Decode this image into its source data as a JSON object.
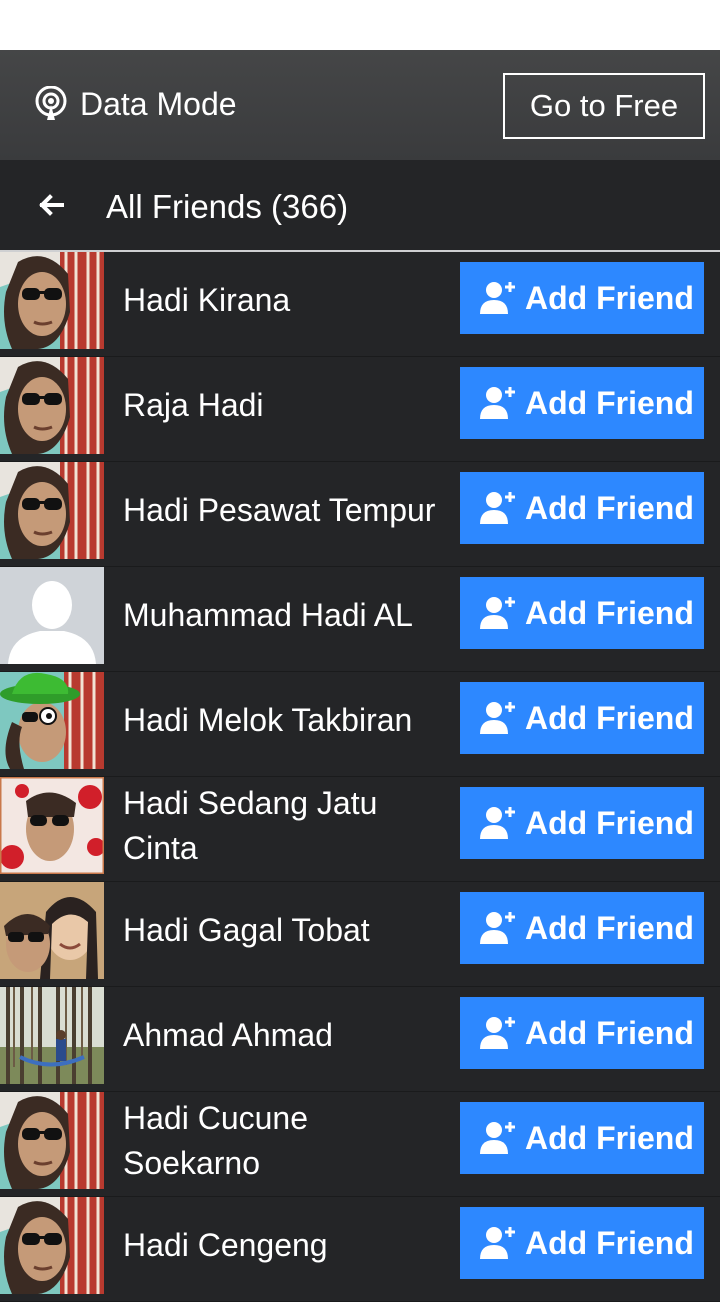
{
  "colors": {
    "accent": "#2d88ff",
    "background": "#242527",
    "topbar": "#3f4042"
  },
  "data_mode": {
    "label": "Data Mode",
    "icon": "broadcast-icon",
    "go_free_label": "Go to Free"
  },
  "header": {
    "back_icon": "arrow-left-icon",
    "title": "All Friends (366)"
  },
  "friends": [
    {
      "name": "Hadi Kirana",
      "button": "Add Friend",
      "avatar": "sunglasses-photo"
    },
    {
      "name": "Raja Hadi",
      "button": "Add Friend",
      "avatar": "sunglasses-photo"
    },
    {
      "name": "Hadi Pesawat Tempur",
      "button": "Add Friend",
      "avatar": "sunglasses-photo"
    },
    {
      "name": "Muhammad Hadi AL",
      "button": "Add Friend",
      "avatar": "default-silhouette"
    },
    {
      "name": "Hadi Melok Takbiran",
      "button": "Add Friend",
      "avatar": "green-hat-photo"
    },
    {
      "name": "Hadi Sedang Jatu Cinta",
      "button": "Add Friend",
      "avatar": "roses-photo"
    },
    {
      "name": "Hadi Gagal Tobat",
      "button": "Add Friend",
      "avatar": "couple-photo"
    },
    {
      "name": "Ahmad Ahmad",
      "button": "Add Friend",
      "avatar": "forest-photo"
    },
    {
      "name": "Hadi Cucune Soekarno",
      "button": "Add Friend",
      "avatar": "sunglasses-photo"
    },
    {
      "name": "Hadi Cengeng",
      "button": "Add Friend",
      "avatar": "sunglasses-photo"
    }
  ]
}
